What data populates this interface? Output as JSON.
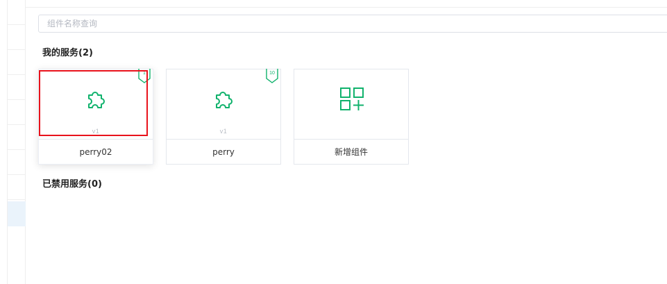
{
  "search": {
    "placeholder": "组件名称查询"
  },
  "my_services": {
    "title": "我的服务(2)"
  },
  "cards": [
    {
      "name": "perry02",
      "version": "v1",
      "badge": "1",
      "icon": "puzzle-icon"
    },
    {
      "name": "perry",
      "version": "v1",
      "badge": "10",
      "icon": "puzzle-icon"
    },
    {
      "name": "新增组件",
      "icon": "add-component-icon"
    }
  ],
  "disabled_services": {
    "title": "已禁用服务(0)"
  },
  "colors": {
    "accent": "#10b26c",
    "highlight": "#e8121b",
    "border": "#e4e7ed"
  }
}
